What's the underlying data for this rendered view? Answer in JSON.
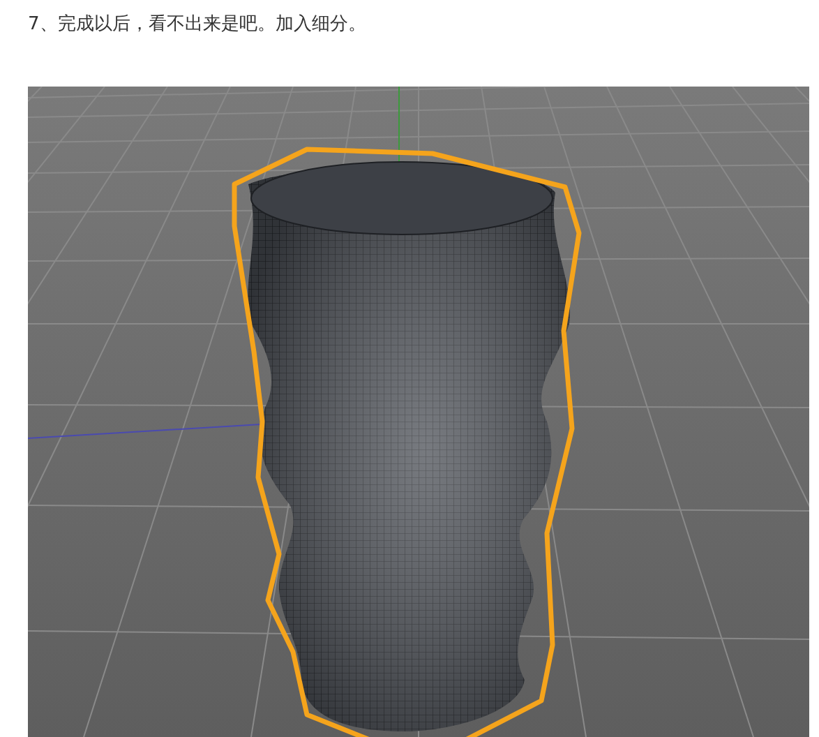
{
  "step_text": "7、完成以后，看不出来是吧。加入细分。"
}
